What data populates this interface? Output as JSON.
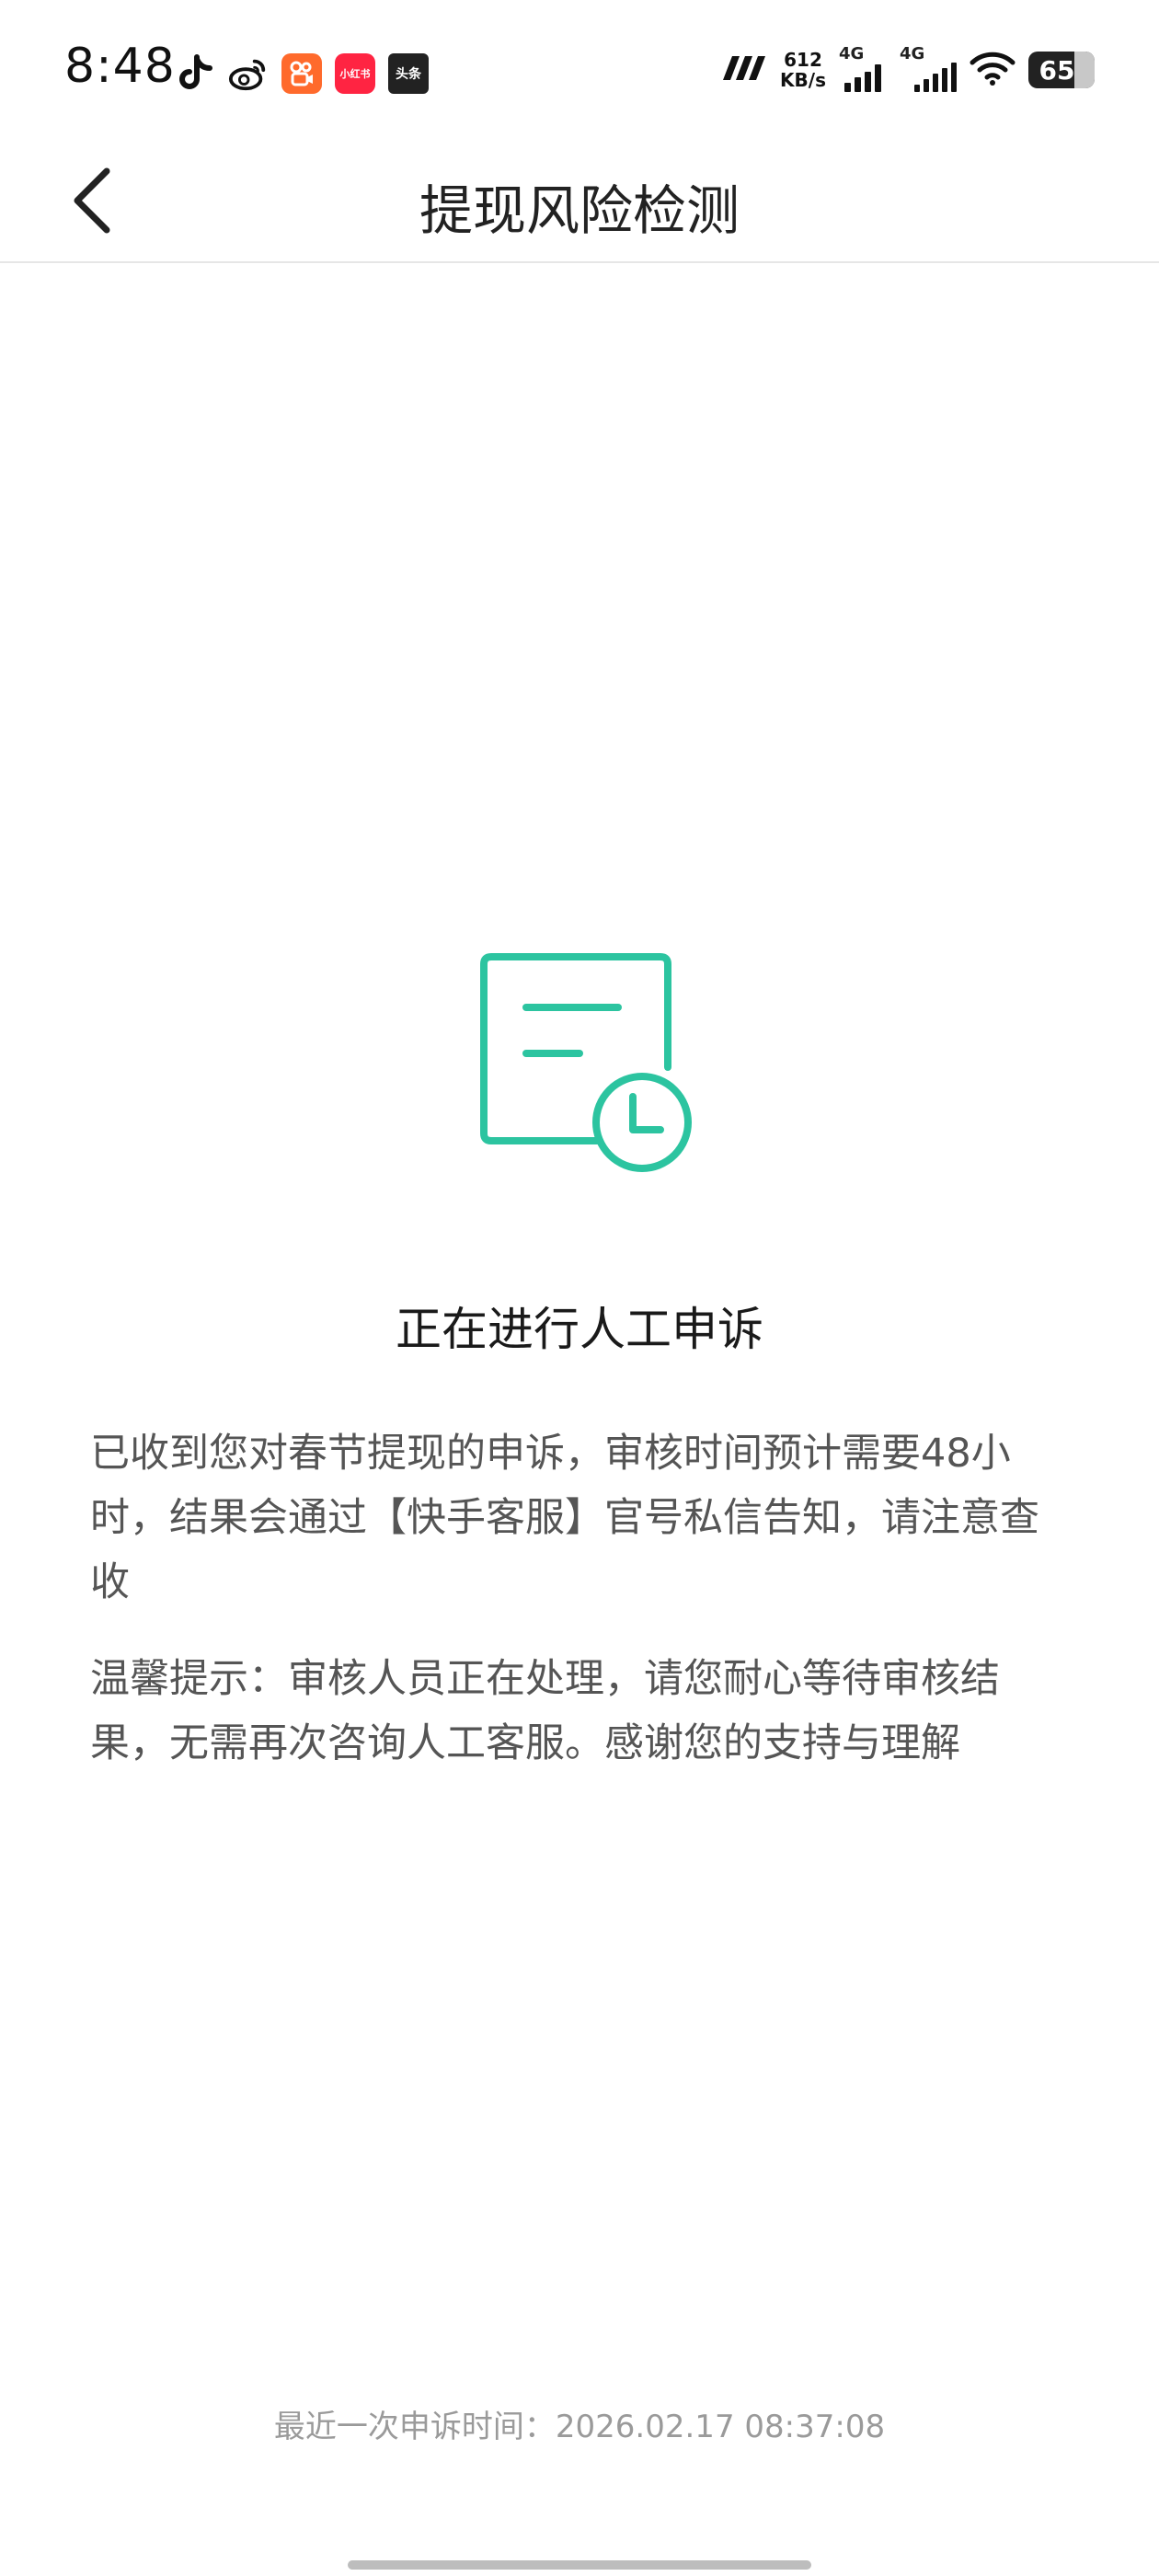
{
  "status_bar": {
    "time": "8:48",
    "notification_icons": [
      "douyin-icon",
      "weibo-icon",
      "kuaishou-icon",
      "xiaohongshu-icon",
      "toutiao-icon"
    ],
    "xiaohongshu_label": "小红书",
    "toutiao_label": "头条",
    "net_speed_value": "612",
    "net_speed_unit": "KB/s",
    "signal_1_label": "4G",
    "signal_2_label": "4G",
    "battery_level": "65"
  },
  "nav": {
    "title": "提现风险检测",
    "back_icon": "chevron-left-icon"
  },
  "main": {
    "status_icon": "document-clock-icon",
    "accent_color": "#2cc4a0",
    "status_title": "正在进行人工申诉",
    "message_1": "已收到您对春节提现的申诉，审核时间预计需要48小时，结果会通过【快手客服】官号私信告知，请注意查收",
    "message_2": "温馨提示：审核人员正在处理，请您耐心等待审核结果，无需再次咨询人工客服。感谢您的支持与理解"
  },
  "footer": {
    "last_appeal_time": "最近一次申诉时间：2026.02.17 08:37:08"
  }
}
